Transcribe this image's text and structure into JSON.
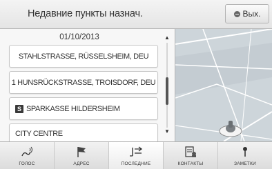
{
  "header": {
    "title": "Недавние пункты назнач.",
    "exit_label": "Вых."
  },
  "list": {
    "group_date": "01/10/2013",
    "items": [
      {
        "label": "STAHLSTRASSE, RÜSSELSHEIM, DEU",
        "icon": null
      },
      {
        "label": "1 HUNSRÜCKSTRASSE, TROISDORF, DEU",
        "icon": null
      },
      {
        "label": "SPARKASSE HILDERSHEIM",
        "icon": "S"
      },
      {
        "label": "CITY CENTRE",
        "icon": null
      }
    ]
  },
  "tabs": [
    {
      "label": "ГОЛОС",
      "icon": "voice-icon",
      "active": false
    },
    {
      "label": "АДРЕС",
      "icon": "flag-icon",
      "active": false
    },
    {
      "label": "ПОСЛЕДНИЕ",
      "icon": "recent-icon",
      "active": true
    },
    {
      "label": "КОНТАКТЫ",
      "icon": "contacts-icon",
      "active": false
    },
    {
      "label": "ЗАМЕТКИ",
      "icon": "pin-icon",
      "active": false
    }
  ],
  "colors": {
    "map_bg": "#cbd3d8",
    "road": "#ffffff",
    "accent_dark": "#333333"
  }
}
